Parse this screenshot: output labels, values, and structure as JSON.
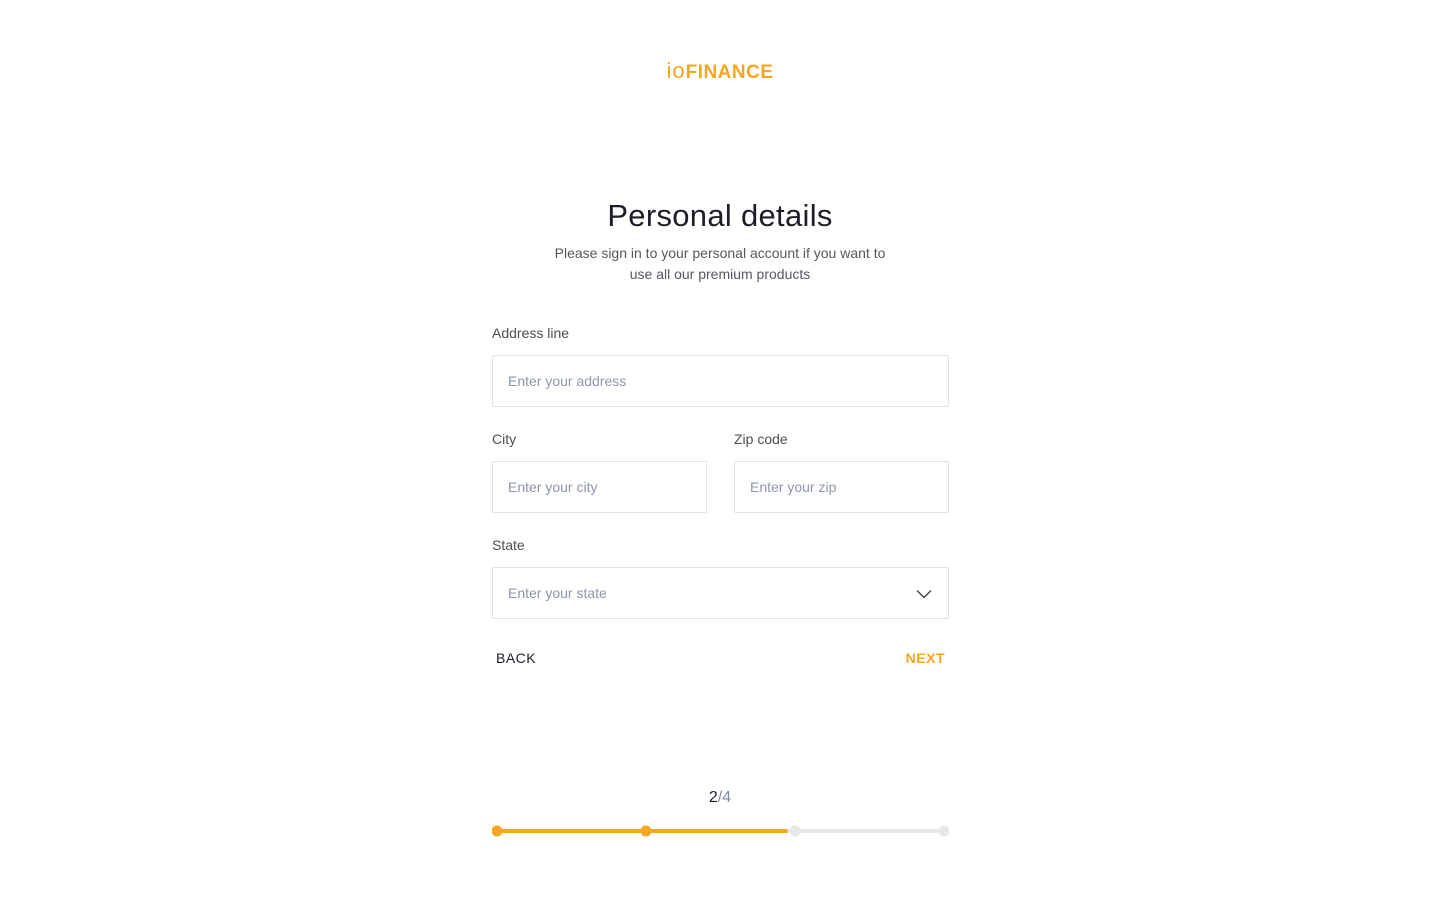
{
  "logo": {
    "prefix": "io",
    "suffix": "FINANCE"
  },
  "header": {
    "title": "Personal details",
    "subtitle": "Please sign in to your personal account if you want to use all our premium products"
  },
  "form": {
    "address": {
      "label": "Address line",
      "placeholder": "Enter your address"
    },
    "city": {
      "label": "City",
      "placeholder": "Enter your city"
    },
    "zip": {
      "label": "Zip code",
      "placeholder": "Enter your zip"
    },
    "state": {
      "label": "State",
      "placeholder": "Enter your state"
    }
  },
  "actions": {
    "back_label": "BACK",
    "next_label": "NEXT"
  },
  "progress": {
    "current": "2",
    "separator": "/",
    "total": "4",
    "current_step": 2,
    "total_steps": 4,
    "fill_fraction": 0.65
  },
  "colors": {
    "accent": "#f5a623",
    "inactive": "#e8e8e8",
    "border": "#e0e2e6",
    "placeholder": "#8d97a8",
    "text": "#1e1e28"
  },
  "icons": {
    "state_dropdown": "chevron-down-icon"
  }
}
